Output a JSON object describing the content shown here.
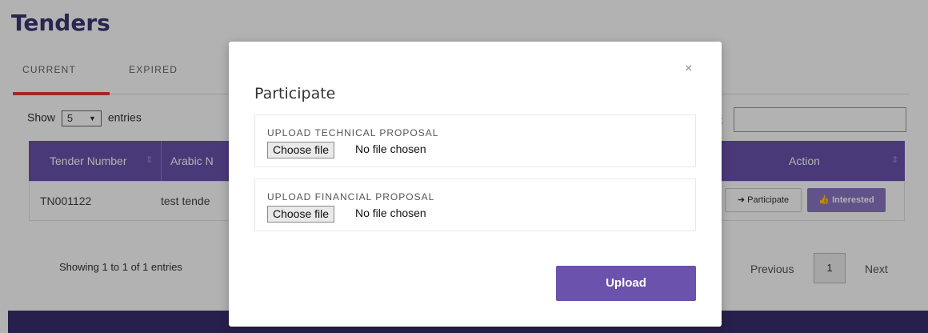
{
  "page": {
    "title": "Tenders",
    "tabs": [
      {
        "label": "CURRENT"
      },
      {
        "label": "EXPIRED"
      }
    ],
    "length_control": {
      "prefix": "Show",
      "value": "5",
      "suffix": "entries"
    },
    "search": {
      "label": ":"
    },
    "table": {
      "headers": [
        "Tender Number",
        "Arabic N",
        "Action"
      ],
      "rows": [
        {
          "tender_number": "TN001122",
          "arabic_name": "test tende"
        }
      ],
      "actions": {
        "participate": "Participate",
        "interested": "Interested"
      }
    },
    "info": "Showing 1 to 1 of 1 entries",
    "pagination": {
      "previous": "Previous",
      "current": "1",
      "next": "Next"
    },
    "colors": {
      "accent": "#6b52ac",
      "tab_underline": "#e23b3b",
      "footer": "#3a2f6e"
    }
  },
  "modal": {
    "title": "Participate",
    "close": "×",
    "fields": [
      {
        "label": "UPLOAD TECHNICAL PROPOSAL",
        "button": "Choose file",
        "status": "No file chosen"
      },
      {
        "label": "UPLOAD FINANCIAL PROPOSAL",
        "button": "Choose file",
        "status": "No file chosen"
      }
    ],
    "submit": "Upload"
  }
}
